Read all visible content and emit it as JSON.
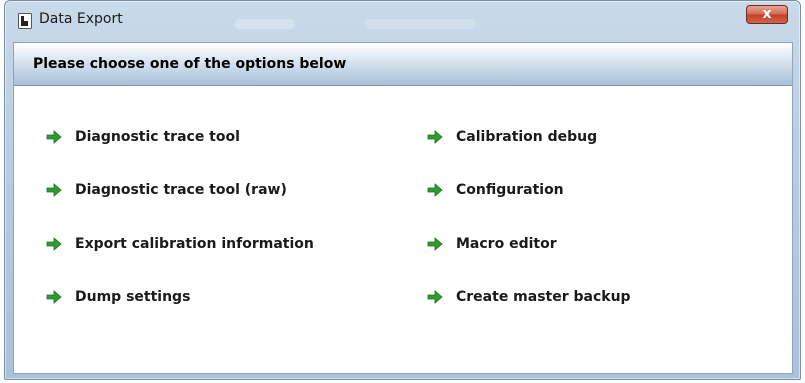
{
  "window": {
    "title": "Data Export",
    "close_label": "x"
  },
  "header": {
    "prompt": "Please choose one of the options below"
  },
  "options_left": [
    {
      "label": "Diagnostic trace tool"
    },
    {
      "label": "Diagnostic trace tool (raw)"
    },
    {
      "label": "Export calibration information"
    },
    {
      "label": "Dump settings"
    }
  ],
  "options_right": [
    {
      "label": "Calibration debug"
    },
    {
      "label": "Configuration"
    },
    {
      "label": "Macro editor"
    },
    {
      "label": "Create master backup"
    }
  ],
  "icons": {
    "window_icon": "application-icon",
    "option_icon": "green-arrow-right-icon",
    "close_icon": "close-icon"
  },
  "colors": {
    "arrow_green": "#2e9d2e",
    "close_red": "#c9452f",
    "header_blue": "#a8c0d8"
  }
}
